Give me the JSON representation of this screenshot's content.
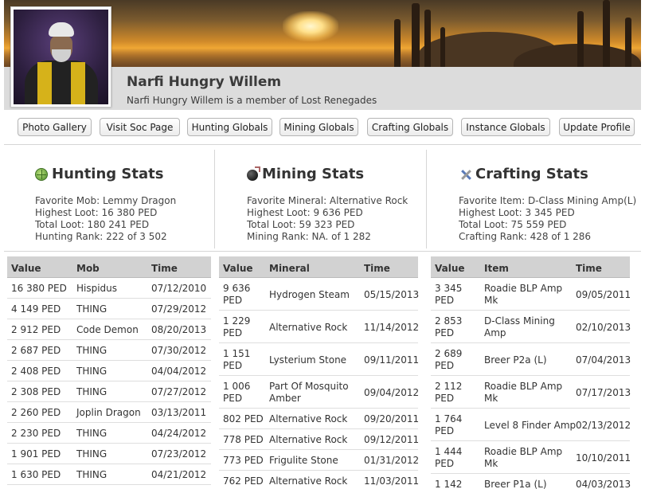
{
  "profile": {
    "name": "Narfi Hungry Willem",
    "membership": "Narfi Hungry Willem is a member of Lost Renegades"
  },
  "nav": [
    {
      "label": "Photo Gallery"
    },
    {
      "label": "Visit Soc Page"
    },
    {
      "label": "Hunting Globals"
    },
    {
      "label": "Mining Globals"
    },
    {
      "label": "Crafting Globals"
    },
    {
      "label": "Instance Globals"
    },
    {
      "label": "Update Profile"
    }
  ],
  "hunting": {
    "title": "Hunting Stats",
    "icon": "crosshair-globe-icon",
    "favorite": "Favorite Mob: Lemmy Dragon",
    "highest": "Highest Loot: 16 380 PED",
    "total": "Total Loot: 180 241 PED",
    "rank": "Hunting Rank: 222 of 3 502",
    "columns": [
      "Value",
      "Mob",
      "Time"
    ],
    "rows": [
      {
        "value": "16 380 PED",
        "name": "Hispidus",
        "time": "07/12/2010"
      },
      {
        "value": "4 149 PED",
        "name": "THING",
        "time": "07/29/2012"
      },
      {
        "value": "2 912 PED",
        "name": "Code Demon",
        "time": "08/20/2013"
      },
      {
        "value": "2 687 PED",
        "name": "THING",
        "time": "07/30/2012"
      },
      {
        "value": "2 408 PED",
        "name": "THING",
        "time": "04/04/2012"
      },
      {
        "value": "2 308 PED",
        "name": "THING",
        "time": "07/27/2012"
      },
      {
        "value": "2 260 PED",
        "name": "Joplin Dragon",
        "time": "03/13/2011"
      },
      {
        "value": "2 230 PED",
        "name": "THING",
        "time": "04/24/2012"
      },
      {
        "value": "1 901 PED",
        "name": "THING",
        "time": "07/23/2012"
      },
      {
        "value": "1 630 PED",
        "name": "THING",
        "time": "04/21/2012"
      }
    ]
  },
  "mining": {
    "title": "Mining Stats",
    "icon": "bomb-icon",
    "favorite": "Favorite Mineral: Alternative Rock",
    "highest": "Highest Loot: 9 636 PED",
    "total": "Total Loot: 59 323 PED",
    "rank": "Mining Rank: NA. of 1 282",
    "columns": [
      "Value",
      "Mineral",
      "Time"
    ],
    "rows": [
      {
        "value": "9 636\nPED",
        "name": "Hydrogen Steam",
        "time": "05/15/2013"
      },
      {
        "value": "1 229\nPED",
        "name": "Alternative Rock",
        "time": "11/14/2012"
      },
      {
        "value": "1 151\nPED",
        "name": "Lysterium Stone",
        "time": "09/11/2011"
      },
      {
        "value": "1 006\nPED",
        "name": "Part Of Mosquito\nAmber",
        "time": "09/04/2012"
      },
      {
        "value": "802 PED",
        "name": "Alternative Rock",
        "time": "09/20/2011"
      },
      {
        "value": "778 PED",
        "name": "Alternative Rock",
        "time": "09/12/2011"
      },
      {
        "value": "773 PED",
        "name": "Frigulite Stone",
        "time": "01/31/2012"
      },
      {
        "value": "762 PED",
        "name": "Alternative Rock",
        "time": "11/03/2011"
      }
    ]
  },
  "crafting": {
    "title": "Crafting Stats",
    "icon": "tools-icon",
    "favorite": "Favorite Item: D-Class Mining Amp(L)",
    "highest": "Highest Loot: 3 345 PED",
    "total": "Total Loot: 75 559 PED",
    "rank": "Crafting Rank: 428 of 1 286",
    "columns": [
      "Value",
      "Item",
      "Time"
    ],
    "rows": [
      {
        "value": "3 345\nPED",
        "name": "Roadie BLP Amp\nMk",
        "time": "09/05/2011"
      },
      {
        "value": "2 853\nPED",
        "name": "D-Class Mining\nAmp",
        "time": "02/10/2013"
      },
      {
        "value": "2 689\nPED",
        "name": "Breer P2a (L)",
        "time": "07/04/2013"
      },
      {
        "value": "2 112\nPED",
        "name": "Roadie BLP Amp\nMk",
        "time": "07/17/2013"
      },
      {
        "value": "1 764\nPED",
        "name": "Level 8 Finder Amp",
        "time": "02/13/2012"
      },
      {
        "value": "1 444\nPED",
        "name": "Roadie BLP Amp\nMk",
        "time": "10/10/2011"
      },
      {
        "value": "1 142",
        "name": "Breer P1a (L)",
        "time": "04/03/2013"
      }
    ]
  }
}
